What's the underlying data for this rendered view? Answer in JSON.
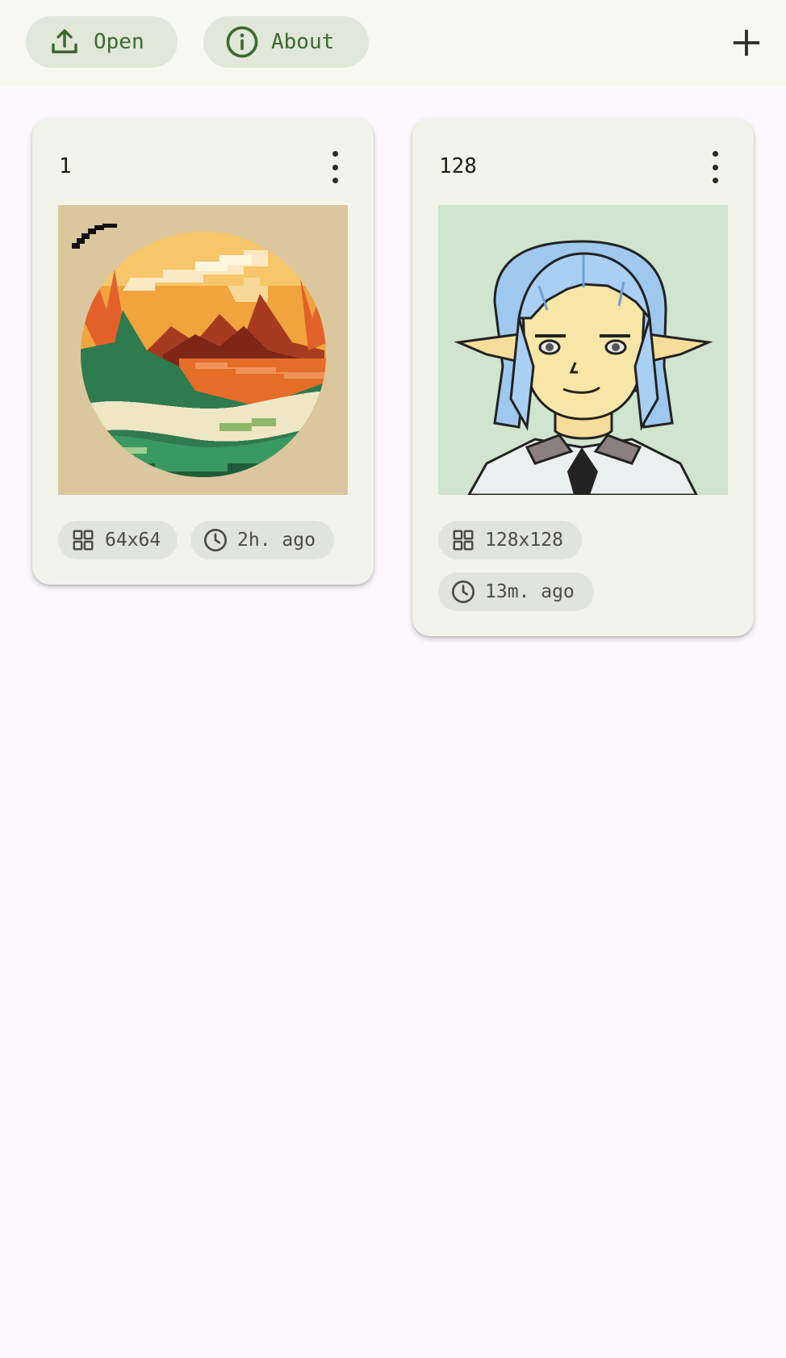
{
  "toolbar": {
    "open_label": "Open",
    "about_label": "About",
    "open_icon": "upload-icon",
    "about_icon": "info-icon",
    "add_icon": "plus-icon"
  },
  "colors": {
    "accent": "#3c6a32",
    "topbar_bg": "#f7f9f0",
    "page_bg": "#fcf8fd",
    "card_bg": "#f2f4ea",
    "chip_bg": "#e1e4da"
  },
  "projects": [
    {
      "title": "1",
      "size_label": "64x64",
      "time_label": "2h. ago",
      "thumbnail": "pixel-art-landscape"
    },
    {
      "title": "128",
      "size_label": "128x128",
      "time_label": "13m. ago",
      "thumbnail": "pixel-art-elf-portrait"
    }
  ]
}
